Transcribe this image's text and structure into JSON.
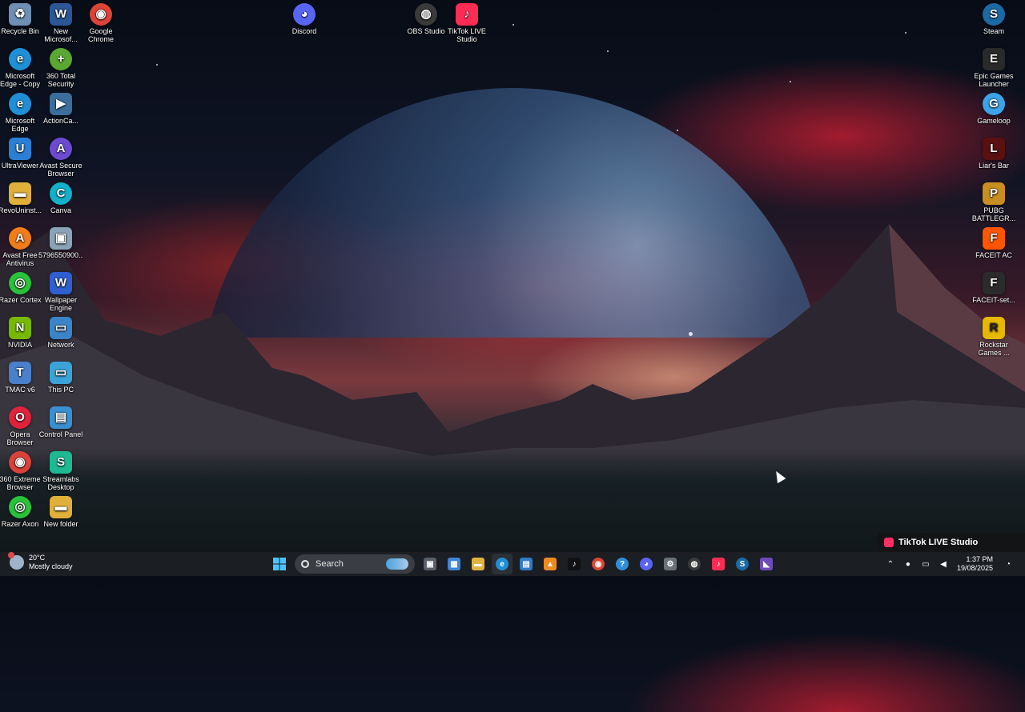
{
  "desktop_icons_left": [
    {
      "label": "Recycle Bin",
      "icon": "recycle-bin-icon",
      "color": "#6f8fb5",
      "glyph": "♻"
    },
    {
      "label": "New Microsof...",
      "icon": "word-document-icon",
      "color": "#2b5797",
      "glyph": "W"
    },
    {
      "label": "Google Chrome",
      "icon": "chrome-icon",
      "color": "#db4437",
      "glyph": "◉"
    },
    {
      "label": "Microsoft Edge - Copy",
      "icon": "edge-icon",
      "color": "#1f8fd6",
      "glyph": "e"
    },
    {
      "label": "360 Total Security",
      "icon": "360-security-icon",
      "color": "#5aa832",
      "glyph": "+"
    },
    {
      "label": "Microsoft Edge",
      "icon": "edge-icon",
      "color": "#1f8fd6",
      "glyph": "e"
    },
    {
      "label": "ActionCa...",
      "icon": "action-camera-icon",
      "color": "#3b6e9c",
      "glyph": "▶"
    },
    {
      "label": "UltraViewer",
      "icon": "ultraviewer-icon",
      "color": "#2b7fd4",
      "glyph": "U"
    },
    {
      "label": "Avast Secure Browser",
      "icon": "avast-browser-icon",
      "color": "#6c4bd1",
      "glyph": "A"
    },
    {
      "label": "RevoUninst...",
      "icon": "folder-icon",
      "color": "#e0b03a",
      "glyph": "▬"
    },
    {
      "label": "Canva",
      "icon": "canva-icon",
      "color": "#12b0c9",
      "glyph": "C"
    },
    {
      "label": "Avast Free Antivirus",
      "icon": "avast-antivirus-icon",
      "color": "#f07d1a",
      "glyph": "A"
    },
    {
      "label": "5796550900...",
      "icon": "image-file-icon",
      "color": "#8aa3b8",
      "glyph": "▣"
    },
    {
      "label": "Razer Cortex",
      "icon": "razer-cortex-icon",
      "color": "#29c23a",
      "glyph": "◎"
    },
    {
      "label": "Wallpaper Engine",
      "icon": "wallpaper-engine-icon",
      "color": "#2f5fd0",
      "glyph": "W"
    },
    {
      "label": "NVIDIA",
      "icon": "nvidia-icon",
      "color": "#76b900",
      "glyph": "N"
    },
    {
      "label": "Network",
      "icon": "network-icon",
      "color": "#3b84c7",
      "glyph": "▭"
    },
    {
      "label": "TMAC v6",
      "icon": "tmac-icon",
      "color": "#4a7fc9",
      "glyph": "T"
    },
    {
      "label": "This PC",
      "icon": "this-pc-icon",
      "color": "#3aa3d8",
      "glyph": "▭"
    },
    {
      "label": "Opera Browser",
      "icon": "opera-icon",
      "color": "#e0233b",
      "glyph": "O"
    },
    {
      "label": "Control Panel",
      "icon": "control-panel-icon",
      "color": "#3a8fd1",
      "glyph": "▤"
    },
    {
      "label": "360 Extreme Browser",
      "icon": "360-browser-icon",
      "color": "#d8423a",
      "glyph": "◉"
    },
    {
      "label": "Streamlabs Desktop",
      "icon": "streamlabs-icon",
      "color": "#1db992",
      "glyph": "S"
    },
    {
      "label": "Razer Axon",
      "icon": "razer-axon-icon",
      "color": "#29c23a",
      "glyph": "◎"
    },
    {
      "label": "New folder",
      "icon": "folder-icon",
      "color": "#e0b03a",
      "glyph": "▬"
    }
  ],
  "desktop_icons_top": [
    {
      "label": "Discord",
      "icon": "discord-icon",
      "color": "#5865f2",
      "glyph": "◕"
    },
    {
      "label": "OBS Studio",
      "icon": "obs-icon",
      "color": "#3a3a3a",
      "glyph": "◍"
    },
    {
      "label": "TikTok LIVE Studio",
      "icon": "tiktok-live-icon",
      "color": "#fe2c55",
      "glyph": "♪"
    }
  ],
  "desktop_icons_right": [
    {
      "label": "Steam",
      "icon": "steam-icon",
      "color": "#1b6aa5",
      "glyph": "S"
    },
    {
      "label": "Epic Games Launcher",
      "icon": "epic-games-icon",
      "color": "#2a2a2a",
      "glyph": "E"
    },
    {
      "label": "Gameloop",
      "icon": "gameloop-icon",
      "color": "#3da3e8",
      "glyph": "G"
    },
    {
      "label": "Liar's Bar",
      "icon": "liars-bar-icon",
      "color": "#5a1010",
      "glyph": "L"
    },
    {
      "label": "PUBG BATTLEGR...",
      "icon": "pubg-icon",
      "color": "#c98e22",
      "glyph": "P"
    },
    {
      "label": "FACEIT AC",
      "icon": "faceit-ac-icon",
      "color": "#ff5500",
      "glyph": "F"
    },
    {
      "label": "FACEIT-set...",
      "icon": "faceit-setup-icon",
      "color": "#2b2b2b",
      "glyph": "F"
    },
    {
      "label": "Rockstar Games ...",
      "icon": "rockstar-icon",
      "color": "#e6b800",
      "glyph": "R"
    }
  ],
  "tiktok_banner": {
    "label": "TikTok LIVE Studio"
  },
  "weather": {
    "temp": "20°C",
    "condition": "Mostly cloudy"
  },
  "search": {
    "placeholder": "Search"
  },
  "taskbar_apps": [
    {
      "name": "task-view",
      "color": "#5a5f6a",
      "glyph": "▣"
    },
    {
      "name": "widgets",
      "color": "#3d86d6",
      "glyph": "▦"
    },
    {
      "name": "file-explorer",
      "color": "#e3b341",
      "glyph": "▬"
    },
    {
      "name": "edge",
      "color": "#1f8fd6",
      "glyph": "e"
    },
    {
      "name": "store",
      "color": "#2f7bc7",
      "glyph": "▤"
    },
    {
      "name": "vlc",
      "color": "#f08a1c",
      "glyph": "▲"
    },
    {
      "name": "tiktok",
      "color": "#111111",
      "glyph": "♪"
    },
    {
      "name": "chrome",
      "color": "#db4437",
      "glyph": "◉"
    },
    {
      "name": "help",
      "color": "#2f8fd6",
      "glyph": "?"
    },
    {
      "name": "discord",
      "color": "#5865f2",
      "glyph": "◕"
    },
    {
      "name": "settings",
      "color": "#6a7078",
      "glyph": "⚙"
    },
    {
      "name": "obs",
      "color": "#3a3a3a",
      "glyph": "◍"
    },
    {
      "name": "tiktok-live",
      "color": "#fe2c55",
      "glyph": "♪"
    },
    {
      "name": "steam",
      "color": "#1b6aa5",
      "glyph": "S"
    },
    {
      "name": "visual-studio",
      "color": "#6e4ab8",
      "glyph": "◣"
    }
  ],
  "tray": {
    "time": "1:37 PM",
    "date": "19/08/2025"
  }
}
